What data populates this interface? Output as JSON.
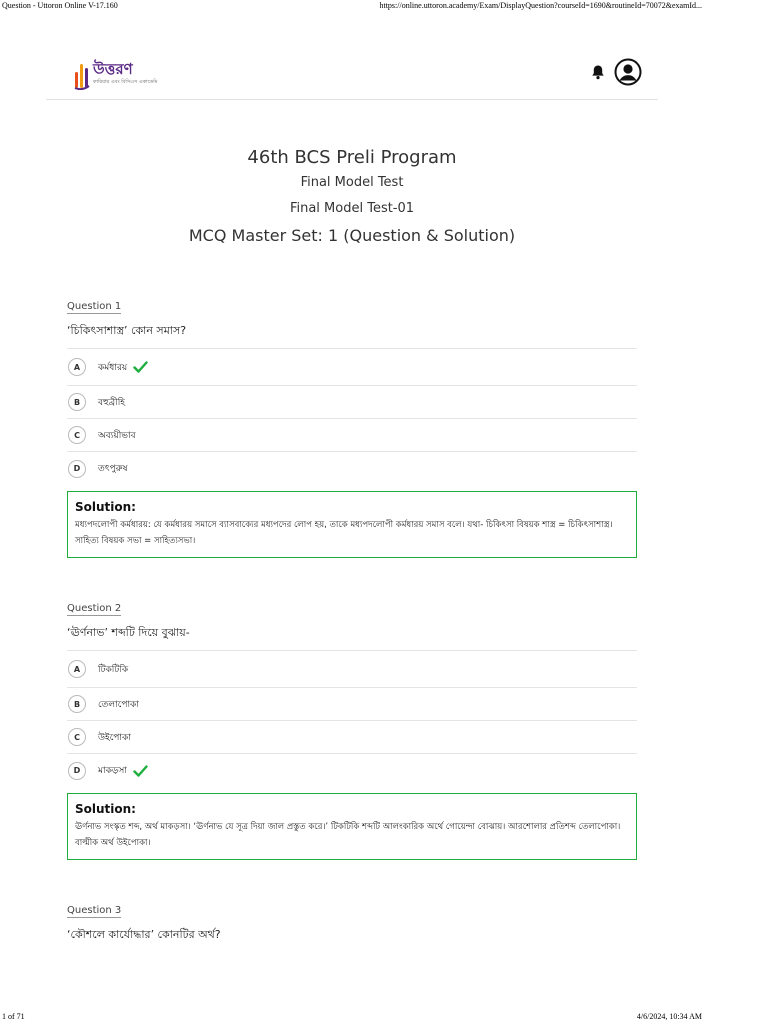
{
  "print": {
    "title": "Question - Uttoron Online V-17.160",
    "url": "https://online.uttoron.academy/Exam/DisplayQuestion?courseId=1690&routineId=70072&examId...",
    "page": "1 of 71",
    "datetime": "4/6/2024, 10:34 AM"
  },
  "header": {
    "logo_name": "উত্তরণ",
    "logo_tagline": "কারিয়ার এবং বিসিএস একাডেমি",
    "icons": [
      "bell-icon",
      "user-icon"
    ]
  },
  "exam": {
    "program": "46th BCS Preli Program",
    "test_type": "Final Model Test",
    "test_name": "Final Model Test-01",
    "set_title": "MCQ Master Set: 1 (Question & Solution)"
  },
  "questions": [
    {
      "label": "Question 1",
      "text": "‘চিকিৎসাশাস্ত্র’ কোন সমাস?",
      "options": [
        {
          "letter": "A",
          "text": "কর্মধারয়",
          "correct": true
        },
        {
          "letter": "B",
          "text": "বহুব্রীহি",
          "correct": false
        },
        {
          "letter": "C",
          "text": "অব্যয়ীভাব",
          "correct": false
        },
        {
          "letter": "D",
          "text": "তৎপুরুষ",
          "correct": false
        }
      ],
      "solution_title": "Solution:",
      "solution_text": "মধ্যপদলোপী কর্মধারয়: যে কর্মধারয় সমাসে ব্যাসবাক্যের মধ্যপদের লোপ হয়, তাকে মধ্যপদলোপী কর্মধারয় সমাস বলে। যথা- চিকিৎসা বিষয়ক শাস্ত্র = চিকিৎসাশাস্ত্র। সাহিত্য বিষয়ক সভা = সাহিত্যসভা।"
    },
    {
      "label": "Question 2",
      "text": "‘ঊর্ণনাভ’ শব্দটি দিয়ে বুঝায়-",
      "options": [
        {
          "letter": "A",
          "text": "টিকটিকি",
          "correct": false
        },
        {
          "letter": "B",
          "text": "তেলাপোকা",
          "correct": false
        },
        {
          "letter": "C",
          "text": "উইপোকা",
          "correct": false
        },
        {
          "letter": "D",
          "text": "মাকড়সা",
          "correct": true
        }
      ],
      "solution_title": "Solution:",
      "solution_text": "ঊর্ণনাভ সংস্কৃত শব্দ, অর্থ মাকড়সা। ‘ঊর্ণনাভ যে সূত্র দিয়া জাল প্রস্তুত করে।’ টিকটিকি শব্দটি আলংকারিক অর্থে গোয়েন্দা বোঝায়। আরশোলার প্রতিশব্দ তেলাপোকা। বাল্মীক অর্থ উইপোকা।"
    },
    {
      "label": "Question 3",
      "text": "‘কৌশলে কার্যোদ্ধার’ কোনটির অর্থ?"
    }
  ],
  "colors": {
    "correct": "#1eae3e",
    "logo_primary": "#5b2a86",
    "logo_accent": "#f39c12"
  }
}
